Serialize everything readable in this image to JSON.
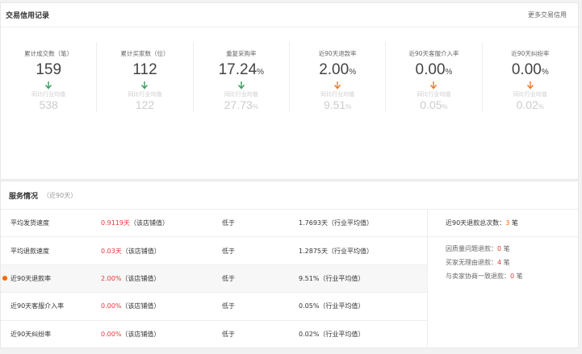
{
  "header": {
    "title": "交易信用记录",
    "more": "更多交易信用"
  },
  "stats": [
    {
      "label": "累计成交数（笔）",
      "value": "159",
      "unit": "",
      "arrow": "down-green",
      "cmp_label": "同比行业均值",
      "cmp_value": "538",
      "cmp_unit": ""
    },
    {
      "label": "累计买家数（位）",
      "value": "112",
      "unit": "",
      "arrow": "down-green",
      "cmp_label": "同比行业均值",
      "cmp_value": "122",
      "cmp_unit": ""
    },
    {
      "label": "重复采购率",
      "value": "17.24",
      "unit": "%",
      "arrow": "down-green",
      "cmp_label": "同比行业均值",
      "cmp_value": "27.73",
      "cmp_unit": "%"
    },
    {
      "label": "近90天退款率",
      "value": "2.00",
      "unit": "%",
      "arrow": "down-orange",
      "cmp_label": "同比行业均值",
      "cmp_value": "9.51",
      "cmp_unit": "%"
    },
    {
      "label": "近90天客服介入率",
      "value": "0.00",
      "unit": "%",
      "arrow": "down-orange",
      "cmp_label": "同比行业均值",
      "cmp_value": "0.05",
      "cmp_unit": "%"
    },
    {
      "label": "近90天纠纷率",
      "value": "0.00",
      "unit": "%",
      "arrow": "down-orange",
      "cmp_label": "同比行业均值",
      "cmp_value": "0.02",
      "cmp_unit": "%"
    }
  ],
  "service": {
    "title": "服务情况",
    "subtitle": "（近90天）",
    "rows": [
      {
        "name": "平均发货速度",
        "value": "0.9119天",
        "value_note": "（该店铺值）",
        "compare": "低于",
        "industry": "1.7693天（行业平均值）",
        "active": false
      },
      {
        "name": "平均退款速度",
        "value": "0.03天",
        "value_note": "（该店铺值）",
        "compare": "低于",
        "industry": "1.2875天（行业平均值）",
        "active": false
      },
      {
        "name": "近90天退款率",
        "value": "2.00%",
        "value_note": "（该店铺值）",
        "compare": "低于",
        "industry": "9.51%（行业平均值）",
        "active": true
      },
      {
        "name": "近90天客服介入率",
        "value": "0.00%",
        "value_note": "（该店铺值）",
        "compare": "低于",
        "industry": "0.05%（行业平均值）",
        "active": false
      },
      {
        "name": "近90天纠纷率",
        "value": "0.00%",
        "value_note": "（该店铺值）",
        "compare": "低于",
        "industry": "0.02%（行业平均值）",
        "active": false
      }
    ],
    "side": {
      "total_label": "近90天退款总次数：",
      "total_value": "3",
      "total_unit": " 笔",
      "items": [
        {
          "label": "因质量问题退款：",
          "value": "0",
          "unit": " 笔"
        },
        {
          "label": "买家无理由退款：",
          "value": "4",
          "unit": " 笔"
        },
        {
          "label": "与卖家协商一致退款：",
          "value": "0",
          "unit": " 笔"
        }
      ]
    }
  },
  "colors": {
    "green_arrow": "#3a9b5c",
    "orange_arrow": "#f0781e",
    "accent_red": "#e4393c",
    "accent_orange": "#ff6600"
  }
}
